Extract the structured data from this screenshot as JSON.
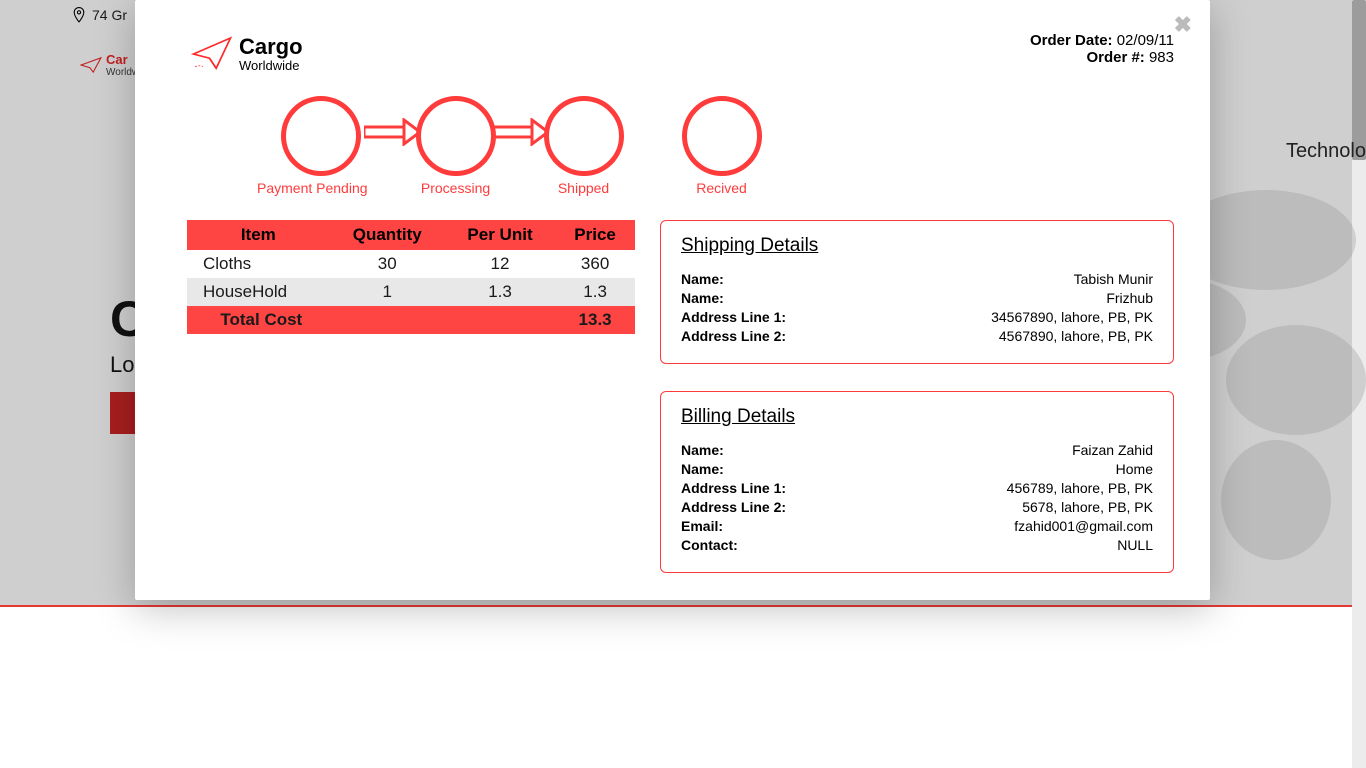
{
  "background": {
    "address": "74 Gr",
    "brand_top": "Car",
    "brand_sub": "Worldw",
    "nav_right": "Technolo",
    "hero_title": "C",
    "hero_sub": "Lo"
  },
  "logo": {
    "line1": "Cargo",
    "line2": "Worldwide"
  },
  "order": {
    "date_label": "Order Date:",
    "date": "02/09/11",
    "num_label": "Order #:",
    "num": "983"
  },
  "status": {
    "s1": "Payment Pending",
    "s2": "Processing",
    "s3": "Shipped",
    "s4": "Recived"
  },
  "table": {
    "headers": {
      "item": "Item",
      "qty": "Quantity",
      "unit": "Per Unit",
      "price": "Price"
    },
    "rows": [
      {
        "item": "Cloths",
        "qty": "30",
        "unit": "12",
        "price": "360"
      },
      {
        "item": "HouseHold",
        "qty": "1",
        "unit": "1.3",
        "price": "1.3"
      }
    ],
    "total_label": "Total Cost",
    "total": "13.3"
  },
  "shipping": {
    "title": "Shipping Details",
    "rows": [
      {
        "k": "Name:",
        "v": "Tabish Munir"
      },
      {
        "k": "Name:",
        "v": "Frizhub"
      },
      {
        "k": "Address Line 1:",
        "v": "34567890, lahore, PB, PK"
      },
      {
        "k": "Address Line 2:",
        "v": "4567890, lahore, PB, PK"
      }
    ]
  },
  "billing": {
    "title": "Billing Details",
    "rows": [
      {
        "k": "Name:",
        "v": "Faizan Zahid"
      },
      {
        "k": "Name:",
        "v": "Home"
      },
      {
        "k": "Address Line 1:",
        "v": "456789, lahore, PB, PK"
      },
      {
        "k": "Address Line 2:",
        "v": "5678, lahore, PB, PK"
      },
      {
        "k": "Email:",
        "v": "fzahid001@gmail.com"
      },
      {
        "k": "Contact:",
        "v": "NULL"
      }
    ]
  }
}
